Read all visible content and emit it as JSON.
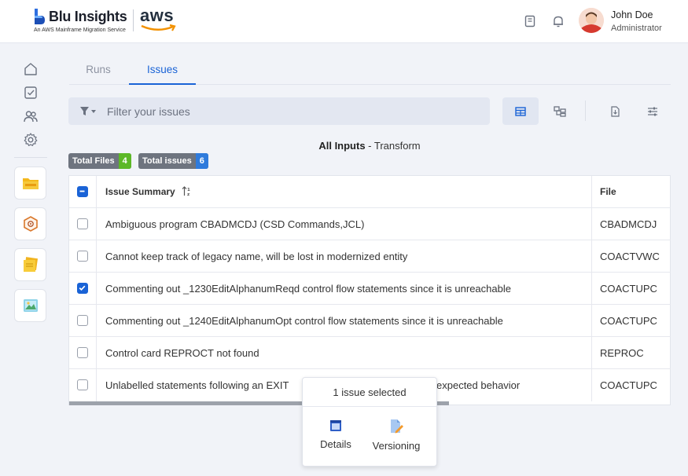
{
  "header": {
    "brand_title": "Blu Insights",
    "brand_subtitle": "An AWS Mainframe Migration Service",
    "aws_text": "aws",
    "user_name": "John Doe",
    "user_role": "Administrator"
  },
  "tabs": [
    {
      "label": "Runs",
      "active": false
    },
    {
      "label": "Issues",
      "active": true
    }
  ],
  "filter": {
    "placeholder": "Filter your issues"
  },
  "title": {
    "bold": "All Inputs",
    "rest": " - Transform"
  },
  "badges": [
    {
      "label": "Total Files",
      "count": "4",
      "color": "#5cb827"
    },
    {
      "label": "Total issues",
      "count": "6",
      "color": "#2f7bdc"
    }
  ],
  "table": {
    "columns": [
      "Issue Summary",
      "File"
    ],
    "rows": [
      {
        "summary": "Ambiguous program CBADMCDJ (CSD Commands,JCL)",
        "file": "CBADMCDJ",
        "checked": false
      },
      {
        "summary": "Cannot keep track of legacy name, will be lost in modernized entity",
        "file": "COACTVWC",
        "checked": false
      },
      {
        "summary": "Commenting out _1230EditAlphanumReqd control flow statements since it is unreachable",
        "file": "COACTUPC",
        "checked": true
      },
      {
        "summary": "Commenting out _1240EditAlphanumOpt control flow statements since it is unreachable",
        "file": "COACTUPC",
        "checked": false
      },
      {
        "summary": "Control card REPROCT not found",
        "file": "REPROC",
        "checked": false
      },
      {
        "summary": "Unlabelled statements following an EXIT",
        "summary_tail": "expected behavior",
        "file": "COACTUPC",
        "checked": false
      }
    ]
  },
  "popup": {
    "title": "1 issue selected",
    "actions": [
      "Details",
      "Versioning"
    ]
  },
  "colors": {
    "accent": "#1a63d6",
    "background": "#f1f3f8"
  }
}
